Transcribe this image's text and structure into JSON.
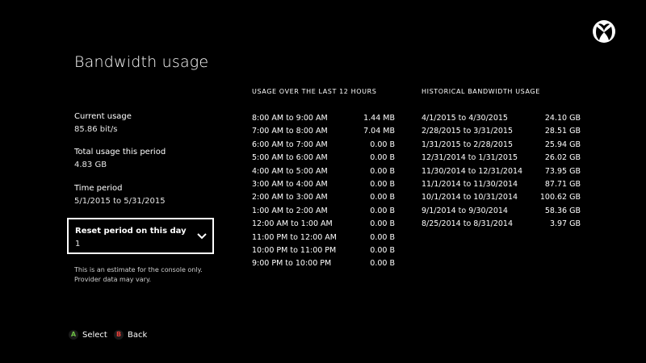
{
  "page": {
    "title": "Bandwidth usage"
  },
  "summary": {
    "current_label": "Current usage",
    "current_value": "85.86 bit/s",
    "total_label": "Total usage this period",
    "total_value": "4.83 GB",
    "period_label": "Time period",
    "period_value": "5/1/2015 to 5/31/2015"
  },
  "reset": {
    "label": "Reset period on this day",
    "value": "1"
  },
  "footnote": {
    "line1": "This is an estimate for the console only.",
    "line2": "Provider data may vary."
  },
  "usage": {
    "header": "USAGE OVER THE LAST 12 HOURS",
    "rows": [
      {
        "range": "8:00 AM to 9:00 AM",
        "amount": "1.44 MB"
      },
      {
        "range": "7:00 AM to 8:00 AM",
        "amount": "7.04 MB"
      },
      {
        "range": "6:00 AM to 7:00 AM",
        "amount": "0.00 B"
      },
      {
        "range": "5:00 AM to 6:00 AM",
        "amount": "0.00 B"
      },
      {
        "range": "4:00 AM to 5:00 AM",
        "amount": "0.00 B"
      },
      {
        "range": "3:00 AM to 4:00 AM",
        "amount": "0.00 B"
      },
      {
        "range": "2:00 AM to 3:00 AM",
        "amount": "0.00 B"
      },
      {
        "range": "1:00 AM to 2:00 AM",
        "amount": "0.00 B"
      },
      {
        "range": "12:00 AM to 1:00 AM",
        "amount": "0.00 B"
      },
      {
        "range": "11:00 PM to 12:00 AM",
        "amount": "0.00 B"
      },
      {
        "range": "10:00 PM to 11:00 PM",
        "amount": "0.00 B"
      },
      {
        "range": "9:00 PM to 10:00 PM",
        "amount": "0.00 B"
      }
    ]
  },
  "history": {
    "header": "HISTORICAL BANDWIDTH USAGE",
    "rows": [
      {
        "range": "4/1/2015 to 4/30/2015",
        "amount": "24.10 GB"
      },
      {
        "range": "2/28/2015 to 3/31/2015",
        "amount": "28.51 GB"
      },
      {
        "range": "1/31/2015 to 2/28/2015",
        "amount": "25.94 GB"
      },
      {
        "range": "12/31/2014 to 1/31/2015",
        "amount": "26.02 GB"
      },
      {
        "range": "11/30/2014 to 12/31/2014",
        "amount": "73.95 GB"
      },
      {
        "range": "11/1/2014 to 11/30/2014",
        "amount": "87.71 GB"
      },
      {
        "range": "10/1/2014 to 10/31/2014",
        "amount": "100.62 GB"
      },
      {
        "range": "9/1/2014 to 9/30/2014",
        "amount": "58.36 GB"
      },
      {
        "range": "8/25/2014 to 8/31/2014",
        "amount": "3.97 GB"
      }
    ]
  },
  "hints": {
    "a_glyph": "A",
    "a_label": "Select",
    "a_color": "#6dbe45",
    "b_glyph": "B",
    "b_label": "Back",
    "b_color": "#e8403a"
  },
  "icons": {
    "logo": "xbox-logo-icon",
    "chevron": "chevron-down-icon"
  }
}
